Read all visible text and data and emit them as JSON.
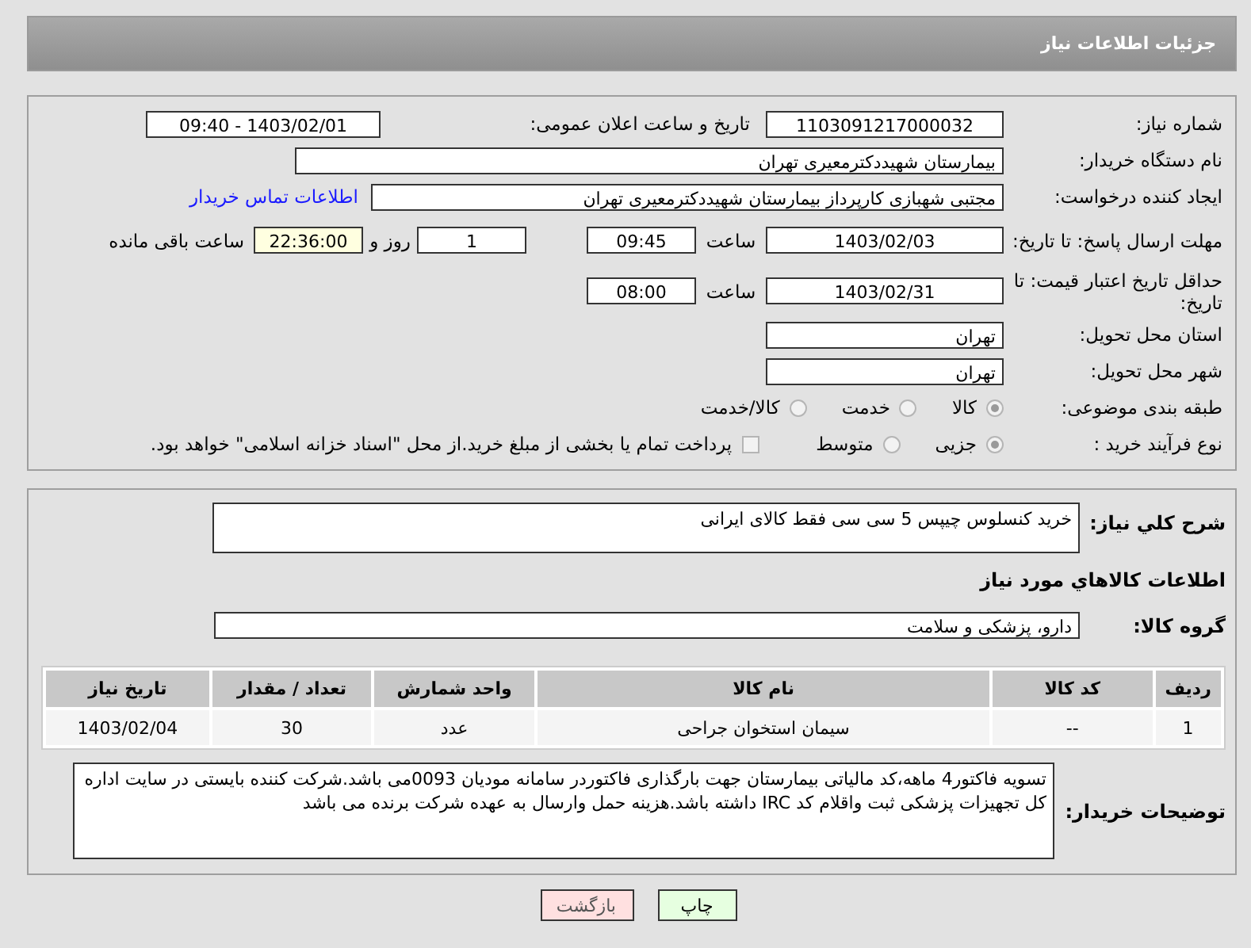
{
  "page_title": "جزئیات اطلاعات نیاز",
  "need_number": {
    "label": "شماره نیاز:",
    "value": "1103091217000032"
  },
  "announce": {
    "label": "تاریخ و ساعت اعلان عمومی:",
    "value": "1403/02/01 - 09:40"
  },
  "buyer_org": {
    "label": "نام دستگاه خریدار:",
    "value": "بیمارستان شهیددکترمعیری تهران"
  },
  "requester": {
    "label": "ایجاد کننده درخواست:",
    "value": "مجتبی  شهبازی کارپرداز بیمارستان شهیددکترمعیری تهران",
    "link": "اطلاعات تماس خریدار"
  },
  "reply_deadline": {
    "label": "مهلت ارسال پاسخ: تا تاریخ:",
    "date": "1403/02/03",
    "time_label": "ساعت",
    "time": "09:45",
    "days": "1",
    "days_label": "روز و",
    "remaining": "22:36:00",
    "remaining_label": "ساعت باقی مانده"
  },
  "price_validity": {
    "label": "حداقل تاریخ اعتبار قیمت: تا تاریخ:",
    "date": "1403/02/31",
    "time_label": "ساعت",
    "time": "08:00"
  },
  "province": {
    "label": "استان محل تحویل:",
    "value": "تهران"
  },
  "city": {
    "label": "شهر محل تحویل:",
    "value": "تهران"
  },
  "category": {
    "label": "طبقه بندی موضوعی:",
    "options": [
      {
        "label": "کالا",
        "selected": true
      },
      {
        "label": "خدمت",
        "selected": false
      },
      {
        "label": "کالا/خدمت",
        "selected": false
      }
    ]
  },
  "process": {
    "label": "نوع فرآیند خرید :",
    "options": [
      {
        "label": "جزیی",
        "selected": true
      },
      {
        "label": "متوسط",
        "selected": false
      }
    ],
    "treasury": {
      "checked": false,
      "text": "پرداخت تمام یا بخشی از مبلغ خرید.از محل \"اسناد خزانه اسلامی\" خواهد بود."
    }
  },
  "summary": {
    "label": "شرح كلي نياز:",
    "value": "خرید کنسلوس چیپس 5 سی سی فقط کالای ایرانی"
  },
  "goods_title": "اطلاعات كالاهاي مورد نياز",
  "goods_group": {
    "label": "گروه کالا:",
    "value": "دارو، پزشکی و سلامت"
  },
  "table": {
    "columns": [
      "ردیف",
      "کد کالا",
      "نام کالا",
      "واحد شمارش",
      "تعداد / مقدار",
      "تاریخ نیاز"
    ],
    "rows": [
      [
        "1",
        "--",
        "سیمان استخوان جراحی",
        "عدد",
        "30",
        "1403/02/04"
      ]
    ]
  },
  "buyer_notes": {
    "label": "توضیحات خریدار:",
    "value": "تسویه فاکتور4 ماهه،کد مالیاتی بیمارستان جهت بارگذاری فاکتوردر سامانه مودیان 0093می باشد.شرکت کننده بایستی در سایت اداره کل تجهیزات پزشکی ثبت واقلام کد IRC داشته باشد.هزینه حمل وارسال به عهده شرکت برنده می باشد"
  },
  "buttons": [
    {
      "label": "چاپ",
      "kind": "print"
    },
    {
      "label": "بازگشت",
      "kind": "back"
    }
  ]
}
